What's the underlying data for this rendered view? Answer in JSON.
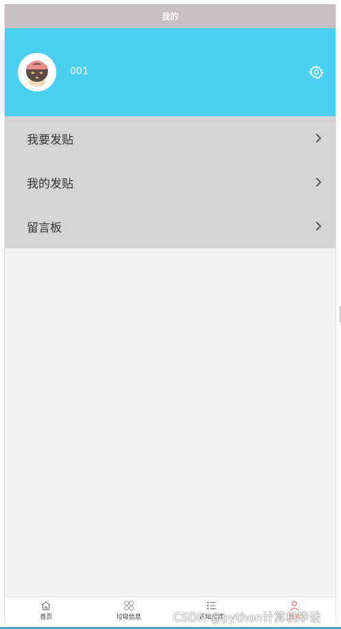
{
  "header": {
    "title": "我的"
  },
  "profile": {
    "username": "001",
    "avatar_icon": "avatar-icon",
    "settings_icon": "gear-icon"
  },
  "menu": {
    "items": [
      {
        "label": "我要发贴",
        "icon": "chevron-right-icon"
      },
      {
        "label": "我的发贴",
        "icon": "chevron-right-icon"
      },
      {
        "label": "留言板",
        "icon": "chevron-right-icon"
      }
    ]
  },
  "tabbar": {
    "tabs": [
      {
        "label": "首页",
        "icon": "home-icon"
      },
      {
        "label": "垃圾信息",
        "icon": "grid-icon"
      },
      {
        "label": "论坛交流",
        "icon": "list-icon"
      },
      {
        "label": "我的",
        "icon": "user-icon"
      }
    ]
  },
  "watermark": "CSDN @python计算机毕设",
  "colors": {
    "header_bg": "#c6bfc0",
    "profile_bg": "#4acff0",
    "menu_bg": "#d6d4d3",
    "page_bg": "#f2f0f3",
    "active_tab": "#e4574d"
  }
}
